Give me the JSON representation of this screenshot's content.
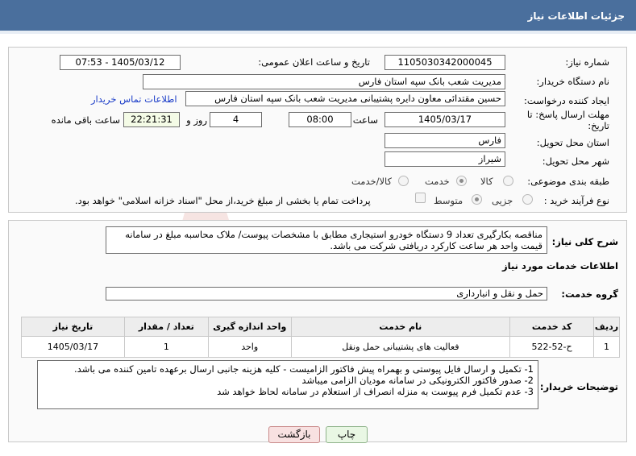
{
  "header": {
    "title": "جزئیات اطلاعات نیاز"
  },
  "form": {
    "need_number": {
      "label": "شماره نیاز:",
      "value": "1105030342000045"
    },
    "announce_datetime": {
      "label": "تاریخ و ساعت اعلان عمومی:",
      "value": "1405/03/12 - 07:53"
    },
    "buyer_org": {
      "label": "نام دستگاه خریدار:",
      "value": "مدیریت شعب بانک سپه استان فارس"
    },
    "requester": {
      "label": "ایجاد کننده درخواست:",
      "value": "حسین مقتدائی معاون  دایره پشتیبانی مدیریت شعب بانک سپه استان فارس"
    },
    "contact_link": "اطلاعات تماس خریدار",
    "deadline": {
      "label": "مهلت ارسال پاسخ: تا تاریخ:",
      "date": "1405/03/17",
      "time_label": "ساعت",
      "time": "08:00",
      "days": "4",
      "days_label": "روز و",
      "remaining": "22:21:31",
      "remaining_label": "ساعت باقی مانده"
    },
    "province": {
      "label": "استان محل تحویل:",
      "value": "فارس"
    },
    "city": {
      "label": "شهر محل تحویل:",
      "value": "شیراز"
    },
    "category": {
      "label": "طبقه بندی موضوعی:",
      "options": [
        "کالا",
        "خدمت",
        "کالا/خدمت"
      ],
      "selected": "خدمت"
    },
    "process": {
      "label": "نوع فرآیند خرید :",
      "options": [
        "جزیی",
        "متوسط"
      ],
      "selected": "متوسط",
      "payment_note": "پرداخت تمام یا بخشی از مبلغ خرید،از محل \"اسناد خزانه اسلامی\" خواهد بود."
    }
  },
  "description": {
    "label": "شرح کلی نیاز:",
    "text": "مناقصه بکارگیری تعداد 9 دستگاه خودرو استیجاری مطابق با مشخصات پیوست/ ملاک محاسبه مبلغ در سامانه قیمت واحد هر ساعت کارکرد دریافتی شرکت می باشد."
  },
  "services": {
    "section_title": "اطلاعات خدمات مورد نیاز",
    "group_label": "گروه خدمت:",
    "group_value": "حمل و نقل و انبارداری",
    "columns": [
      "ردیف",
      "کد خدمت",
      "نام خدمت",
      "واحد اندازه گیری",
      "تعداد / مقدار",
      "تاریخ نیاز"
    ],
    "rows": [
      [
        "1",
        "ح-52-522",
        "فعالیت های پشتیبانی حمل ونقل",
        "واحد",
        "1",
        "1405/03/17"
      ]
    ]
  },
  "buyer_notes": {
    "label": "توضیحات خریدار:",
    "lines": [
      "1-  تکمیل و ارسال فایل پیوستی و بهمراه پیش فاکتور الزامیست - کلیه هزینه جانبی ارسال برعهده تامین کننده می باشد.",
      "2- صدور فاکتور الکترونیکی در سامانه مودیان الزامی میباشد",
      "3- عدم تکمیل فرم پیوست به منزله انصراف از استعلام در سامانه لحاظ خواهد شد"
    ]
  },
  "buttons": {
    "print": "چاپ",
    "back": "بازگشت"
  },
  "colors": {
    "header": "#4a6f9d",
    "link": "#1a3cc8",
    "remaining_bg": "#f4fbe6"
  }
}
